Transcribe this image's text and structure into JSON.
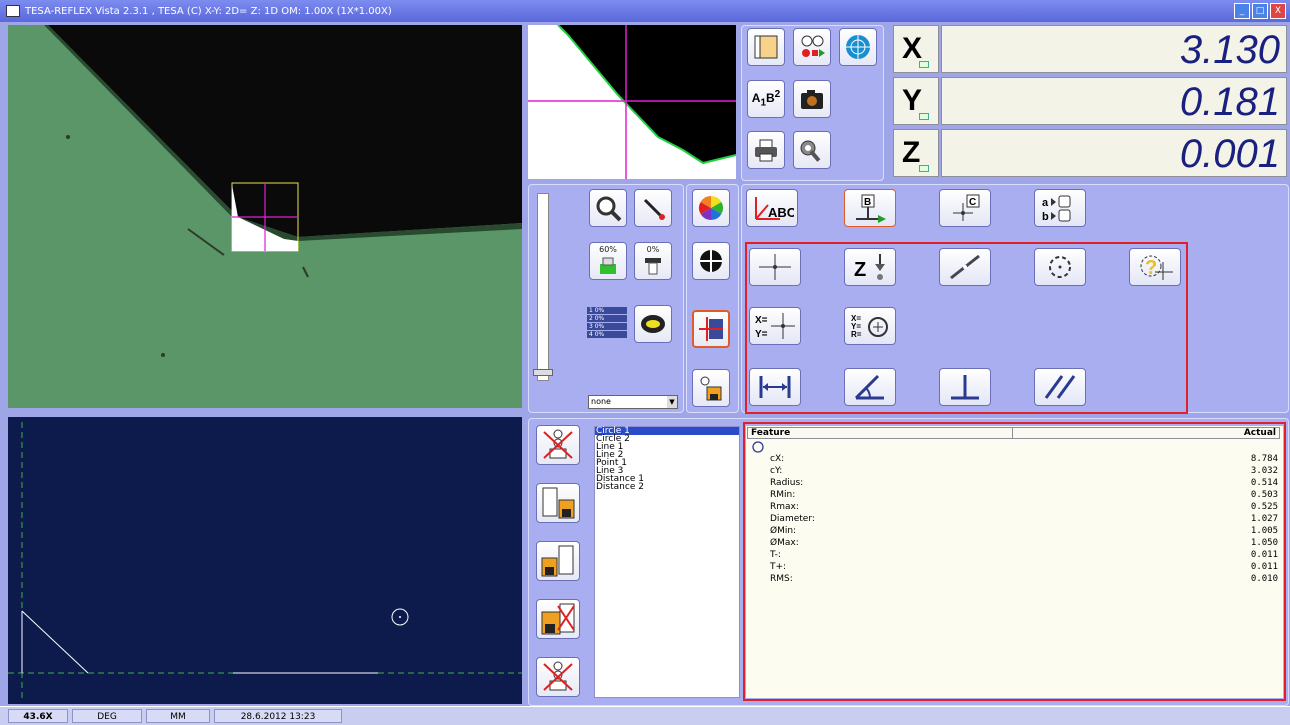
{
  "window": {
    "title": "TESA-REFLEX Vista 2.3.1  ,  TESA (C)      X-Y: 2D=   Z: 1D   OM: 1.00X (1X*1.00X)",
    "controls": [
      "_",
      "□",
      "X"
    ]
  },
  "readout": {
    "x": {
      "axis": "X",
      "value": "3.130"
    },
    "y": {
      "axis": "Y",
      "value": "0.181"
    },
    "z": {
      "axis": "Z",
      "value": "0.001"
    }
  },
  "light": {
    "top_percent": "60%",
    "bottom_percent": "0%",
    "ring_rows": [
      "1 0%",
      "2 0%",
      "3 0%",
      "4 0%"
    ],
    "preset": "none"
  },
  "features": [
    "Circle 1",
    "Circle 2",
    "Line 1",
    "Line 2",
    "Point 1",
    "Line 3",
    "Distance 1",
    "Distance 2"
  ],
  "selected_feature": "Circle 1",
  "results": {
    "header_feature": "Feature",
    "header_actual": "Actual",
    "rows": [
      {
        "label": "cX:",
        "value": "8.784"
      },
      {
        "label": "cY:",
        "value": "3.032"
      },
      {
        "label": "Radius:",
        "value": "0.514"
      },
      {
        "label": "RMin:",
        "value": "0.503"
      },
      {
        "label": "Rmax:",
        "value": "0.525"
      },
      {
        "label": "Diameter:",
        "value": "1.027"
      },
      {
        "label": "ØMin:",
        "value": "1.005"
      },
      {
        "label": "ØMax:",
        "value": "1.050"
      },
      {
        "label": "T-:",
        "value": "0.011"
      },
      {
        "label": "T+:",
        "value": "0.011"
      },
      {
        "label": "RMS:",
        "value": "0.010"
      }
    ]
  },
  "status": {
    "zoom": "43.6X",
    "angle_unit": "DEG",
    "length_unit": "MM",
    "datetime": "28.6.2012 13:23"
  },
  "colors": {
    "accent_red": "#e0202a",
    "panel": "#a9aef0",
    "magenta": "#e020d0"
  }
}
